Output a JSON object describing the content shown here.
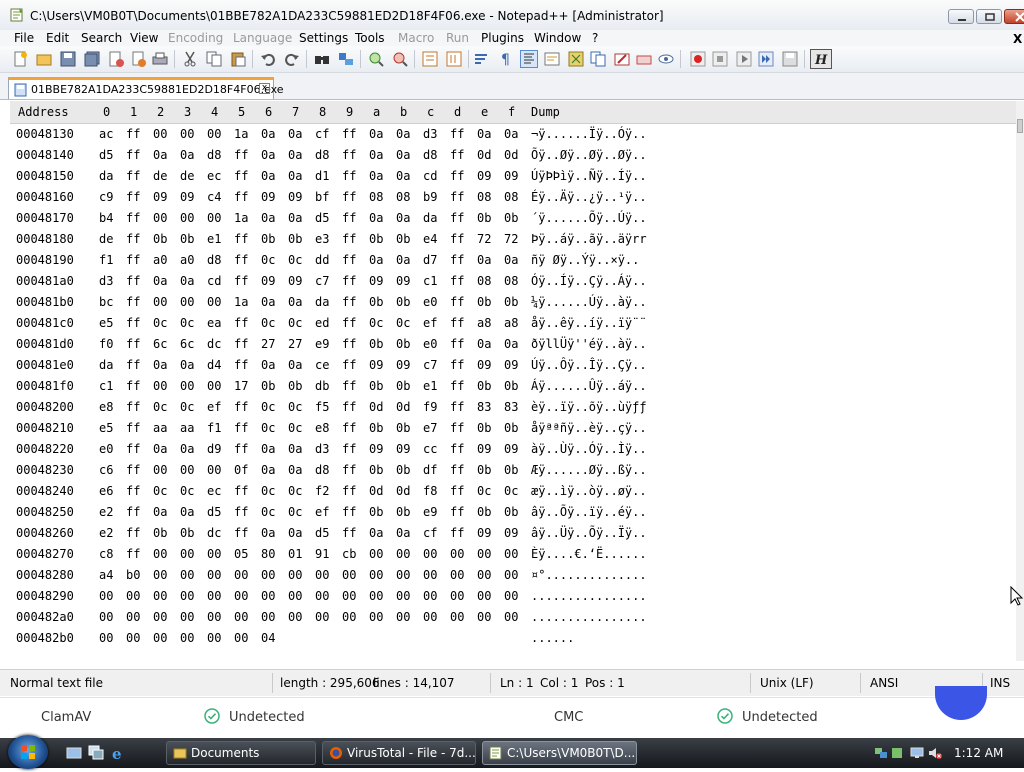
{
  "window": {
    "title": "C:\\Users\\VM0B0T\\Documents\\01BBE782A1DA233C59881ED2D18F4F06.exe - Notepad++ [Administrator]"
  },
  "menu": [
    "File",
    "Edit",
    "Search",
    "View",
    "Encoding",
    "Language",
    "Settings",
    "Tools",
    "Macro",
    "Run",
    "Plugins",
    "Window",
    "?"
  ],
  "menu_disabled": [
    "Encoding",
    "Language",
    "Macro",
    "Run"
  ],
  "menu_close": "X",
  "tab": {
    "label": "01BBE782A1DA233C59881ED2D18F4F06.exe",
    "close": "x"
  },
  "hex": {
    "headers": [
      "Address",
      "0",
      "1",
      "2",
      "3",
      "4",
      "5",
      "6",
      "7",
      "8",
      "9",
      "a",
      "b",
      "c",
      "d",
      "e",
      "f",
      "Dump"
    ],
    "rows": [
      {
        "addr": "00048130",
        "bytes": [
          "ac",
          "ff",
          "00",
          "00",
          "00",
          "1a",
          "0a",
          "0a",
          "cf",
          "ff",
          "0a",
          "0a",
          "d3",
          "ff",
          "0a",
          "0a"
        ],
        "dump": "¬ÿ......Ïÿ..Óÿ.."
      },
      {
        "addr": "00048140",
        "bytes": [
          "d5",
          "ff",
          "0a",
          "0a",
          "d8",
          "ff",
          "0a",
          "0a",
          "d8",
          "ff",
          "0a",
          "0a",
          "d8",
          "ff",
          "0d",
          "0d"
        ],
        "dump": "Õÿ..Øÿ..Øÿ..Øÿ.."
      },
      {
        "addr": "00048150",
        "bytes": [
          "da",
          "ff",
          "de",
          "de",
          "ec",
          "ff",
          "0a",
          "0a",
          "d1",
          "ff",
          "0a",
          "0a",
          "cd",
          "ff",
          "09",
          "09"
        ],
        "dump": "ÚÿÞÞìÿ..Ñÿ..Íÿ.."
      },
      {
        "addr": "00048160",
        "bytes": [
          "c9",
          "ff",
          "09",
          "09",
          "c4",
          "ff",
          "09",
          "09",
          "bf",
          "ff",
          "08",
          "08",
          "b9",
          "ff",
          "08",
          "08"
        ],
        "dump": "Éÿ..Äÿ..¿ÿ..¹ÿ.."
      },
      {
        "addr": "00048170",
        "bytes": [
          "b4",
          "ff",
          "00",
          "00",
          "00",
          "1a",
          "0a",
          "0a",
          "d5",
          "ff",
          "0a",
          "0a",
          "da",
          "ff",
          "0b",
          "0b"
        ],
        "dump": "´ÿ......Õÿ..Úÿ.."
      },
      {
        "addr": "00048180",
        "bytes": [
          "de",
          "ff",
          "0b",
          "0b",
          "e1",
          "ff",
          "0b",
          "0b",
          "e3",
          "ff",
          "0b",
          "0b",
          "e4",
          "ff",
          "72",
          "72"
        ],
        "dump": "Þÿ..áÿ..ãÿ..äÿrr"
      },
      {
        "addr": "00048190",
        "bytes": [
          "f1",
          "ff",
          "a0",
          "a0",
          "d8",
          "ff",
          "0c",
          "0c",
          "dd",
          "ff",
          "0a",
          "0a",
          "d7",
          "ff",
          "0a",
          "0a"
        ],
        "dump": "ñÿ  Øÿ..Ýÿ..×ÿ.."
      },
      {
        "addr": "000481a0",
        "bytes": [
          "d3",
          "ff",
          "0a",
          "0a",
          "cd",
          "ff",
          "09",
          "09",
          "c7",
          "ff",
          "09",
          "09",
          "c1",
          "ff",
          "08",
          "08"
        ],
        "dump": "Óÿ..Íÿ..Çÿ..Áÿ.."
      },
      {
        "addr": "000481b0",
        "bytes": [
          "bc",
          "ff",
          "00",
          "00",
          "00",
          "1a",
          "0a",
          "0a",
          "da",
          "ff",
          "0b",
          "0b",
          "e0",
          "ff",
          "0b",
          "0b"
        ],
        "dump": "¼ÿ......Úÿ..àÿ.."
      },
      {
        "addr": "000481c0",
        "bytes": [
          "e5",
          "ff",
          "0c",
          "0c",
          "ea",
          "ff",
          "0c",
          "0c",
          "ed",
          "ff",
          "0c",
          "0c",
          "ef",
          "ff",
          "a8",
          "a8"
        ],
        "dump": "åÿ..êÿ..íÿ..ïÿ¨¨"
      },
      {
        "addr": "000481d0",
        "bytes": [
          "f0",
          "ff",
          "6c",
          "6c",
          "dc",
          "ff",
          "27",
          "27",
          "e9",
          "ff",
          "0b",
          "0b",
          "e0",
          "ff",
          "0a",
          "0a"
        ],
        "dump": "ðÿllÜÿ''éÿ..àÿ.."
      },
      {
        "addr": "000481e0",
        "bytes": [
          "da",
          "ff",
          "0a",
          "0a",
          "d4",
          "ff",
          "0a",
          "0a",
          "ce",
          "ff",
          "09",
          "09",
          "c7",
          "ff",
          "09",
          "09"
        ],
        "dump": "Úÿ..Ôÿ..Îÿ..Çÿ.."
      },
      {
        "addr": "000481f0",
        "bytes": [
          "c1",
          "ff",
          "00",
          "00",
          "00",
          "17",
          "0b",
          "0b",
          "db",
          "ff",
          "0b",
          "0b",
          "e1",
          "ff",
          "0b",
          "0b"
        ],
        "dump": "Áÿ......Ûÿ..áÿ.."
      },
      {
        "addr": "00048200",
        "bytes": [
          "e8",
          "ff",
          "0c",
          "0c",
          "ef",
          "ff",
          "0c",
          "0c",
          "f5",
          "ff",
          "0d",
          "0d",
          "f9",
          "ff",
          "83",
          "83"
        ],
        "dump": "èÿ..ïÿ..õÿ..ùÿƒƒ"
      },
      {
        "addr": "00048210",
        "bytes": [
          "e5",
          "ff",
          "aa",
          "aa",
          "f1",
          "ff",
          "0c",
          "0c",
          "e8",
          "ff",
          "0b",
          "0b",
          "e7",
          "ff",
          "0b",
          "0b"
        ],
        "dump": "åÿªªñÿ..èÿ..çÿ.."
      },
      {
        "addr": "00048220",
        "bytes": [
          "e0",
          "ff",
          "0a",
          "0a",
          "d9",
          "ff",
          "0a",
          "0a",
          "d3",
          "ff",
          "09",
          "09",
          "cc",
          "ff",
          "09",
          "09"
        ],
        "dump": "àÿ..Ùÿ..Óÿ..Ìÿ.."
      },
      {
        "addr": "00048230",
        "bytes": [
          "c6",
          "ff",
          "00",
          "00",
          "00",
          "0f",
          "0a",
          "0a",
          "d8",
          "ff",
          "0b",
          "0b",
          "df",
          "ff",
          "0b",
          "0b"
        ],
        "dump": "Æÿ......Øÿ..ßÿ.."
      },
      {
        "addr": "00048240",
        "bytes": [
          "e6",
          "ff",
          "0c",
          "0c",
          "ec",
          "ff",
          "0c",
          "0c",
          "f2",
          "ff",
          "0d",
          "0d",
          "f8",
          "ff",
          "0c",
          "0c"
        ],
        "dump": "æÿ..ìÿ..òÿ..øÿ.."
      },
      {
        "addr": "00048250",
        "bytes": [
          "e2",
          "ff",
          "0a",
          "0a",
          "d5",
          "ff",
          "0c",
          "0c",
          "ef",
          "ff",
          "0b",
          "0b",
          "e9",
          "ff",
          "0b",
          "0b"
        ],
        "dump": "âÿ..Õÿ..ïÿ..éÿ.."
      },
      {
        "addr": "00048260",
        "bytes": [
          "e2",
          "ff",
          "0b",
          "0b",
          "dc",
          "ff",
          "0a",
          "0a",
          "d5",
          "ff",
          "0a",
          "0a",
          "cf",
          "ff",
          "09",
          "09"
        ],
        "dump": "âÿ..Üÿ..Õÿ..Ïÿ.."
      },
      {
        "addr": "00048270",
        "bytes": [
          "c8",
          "ff",
          "00",
          "00",
          "00",
          "05",
          "80",
          "01",
          "91",
          "cb",
          "00",
          "00",
          "00",
          "00",
          "00",
          "00"
        ],
        "dump": "Èÿ....€.‘Ë......"
      },
      {
        "addr": "00048280",
        "bytes": [
          "a4",
          "b0",
          "00",
          "00",
          "00",
          "00",
          "00",
          "00",
          "00",
          "00",
          "00",
          "00",
          "00",
          "00",
          "00",
          "00"
        ],
        "dump": "¤°.............."
      },
      {
        "addr": "00048290",
        "bytes": [
          "00",
          "00",
          "00",
          "00",
          "00",
          "00",
          "00",
          "00",
          "00",
          "00",
          "00",
          "00",
          "00",
          "00",
          "00",
          "00"
        ],
        "dump": "................"
      },
      {
        "addr": "000482a0",
        "bytes": [
          "00",
          "00",
          "00",
          "00",
          "00",
          "00",
          "00",
          "00",
          "00",
          "00",
          "00",
          "00",
          "00",
          "00",
          "00",
          "00"
        ],
        "dump": "................"
      },
      {
        "addr": "000482b0",
        "bytes": [
          "00",
          "00",
          "00",
          "00",
          "00",
          "00",
          "04"
        ],
        "dump": "......"
      }
    ]
  },
  "status": {
    "file_type": "Normal text file",
    "length": "length : 295,606",
    "lines": "lines : 14,107",
    "ln": "Ln : 1",
    "col": "Col : 1",
    "pos": "Pos : 1",
    "eol": "Unix (LF)",
    "encoding": "ANSI",
    "mode": "INS"
  },
  "virustotal": {
    "engine1": "ClamAV",
    "result1": "Undetected",
    "engine2": "CMC",
    "result2": "Undetected",
    "check_color": "#3bb27a"
  },
  "taskbar": {
    "tasks": [
      "Documents",
      "VirusTotal - File - 7d...",
      "C:\\Users\\VM0B0T\\D..."
    ],
    "clock": "1:12 AM"
  },
  "colors": {
    "tab_accent": "#f2a23a",
    "taskbar": "#1f2328",
    "fab": "#3b55e6"
  },
  "icons": [
    "notepad-icon",
    "new-file-icon",
    "open-icon",
    "save-icon",
    "save-all-icon",
    "close-icon",
    "close-all-icon",
    "print-icon",
    "cut-icon",
    "copy-icon",
    "paste-icon",
    "undo-icon",
    "redo-icon",
    "find-icon",
    "replace-icon",
    "zoom-in-icon",
    "zoom-out-icon",
    "sync-v-icon",
    "sync-h-icon",
    "wrap-icon",
    "all-chars-icon",
    "indent-guide-icon",
    "doc-map-icon",
    "function-list-icon",
    "folder-workspace-icon",
    "monitor-icon",
    "macro-record-icon",
    "macro-stop-icon",
    "macro-play-icon",
    "macro-run-icon",
    "macro-save-icon",
    "hex-editor-icon",
    "start-orb-icon",
    "ie-icon",
    "firefox-icon",
    "clock"
  ]
}
